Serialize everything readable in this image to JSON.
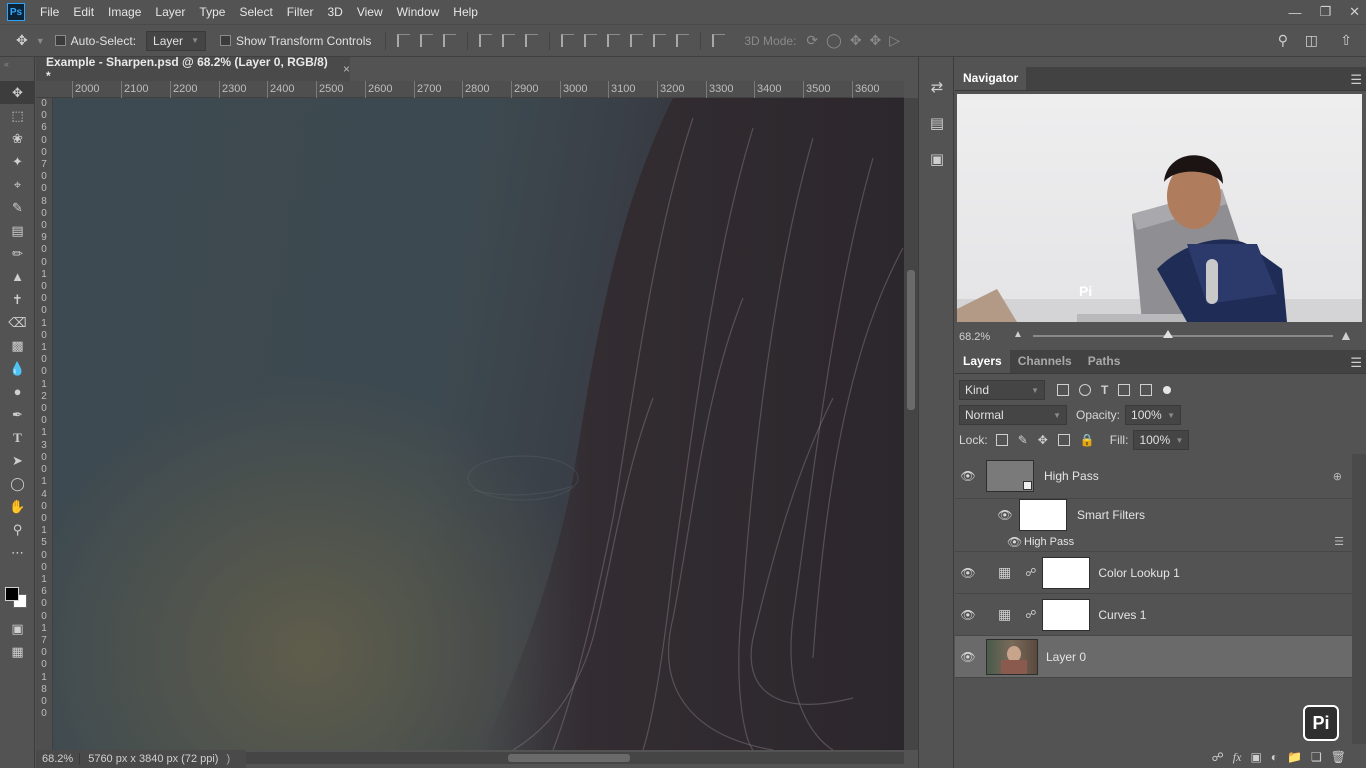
{
  "app": {
    "logo": "Ps",
    "menu": [
      "File",
      "Edit",
      "Image",
      "Layer",
      "Type",
      "Select",
      "Filter",
      "3D",
      "View",
      "Window",
      "Help"
    ],
    "window_controls": [
      "minimize-icon",
      "restore-icon",
      "close-icon"
    ]
  },
  "options": {
    "auto_select_label": "Auto-Select:",
    "auto_select_value": "Layer",
    "show_transform_label": "Show Transform Controls",
    "mode_3d_label": "3D Mode:"
  },
  "document": {
    "tab_title": "Example - Sharpen.psd @ 68.2% (Layer 0, RGB/8) *",
    "close_glyph": "×",
    "ruler_ticks": [
      "2000",
      "2100",
      "2200",
      "2300",
      "2400",
      "2500",
      "2600",
      "2700",
      "2800",
      "2900",
      "3000",
      "3100",
      "3200",
      "3300",
      "3400",
      "3500",
      "3600"
    ],
    "left_ruler_labels": [
      "0",
      "0",
      "6",
      "0",
      "0",
      "7",
      "0",
      "0",
      "8",
      "0",
      "0",
      "9",
      "0",
      "0",
      "1",
      "0",
      "0",
      "0",
      "1",
      "0",
      "1",
      "0",
      "0",
      "1",
      "2",
      "0",
      "0",
      "1",
      "3",
      "0",
      "0",
      "1",
      "4",
      "0",
      "0",
      "1",
      "5",
      "0",
      "0",
      "1",
      "6",
      "0",
      "0",
      "1",
      "7",
      "0",
      "0",
      "1",
      "8",
      "0",
      "0"
    ]
  },
  "status": {
    "zoom": "68.2%",
    "doc_info": "5760 px x 3840 px (72 ppi)",
    "arrow": ")"
  },
  "navigator": {
    "title": "Navigator",
    "zoom": "68.2%",
    "zoom_level": 0.45
  },
  "layers": {
    "tabs": [
      "Layers",
      "Channels",
      "Paths"
    ],
    "active_tab": "Layers",
    "kind_label": "Kind",
    "blend_mode": "Normal",
    "opacity_label": "Opacity:",
    "opacity_value": "100%",
    "lock_label": "Lock:",
    "fill_label": "Fill:",
    "fill_value": "100%",
    "items": [
      {
        "name": "High Pass",
        "type": "smart-object"
      },
      {
        "name": "Smart Filters",
        "type": "smart-filters"
      },
      {
        "name": "High Pass",
        "type": "filter"
      },
      {
        "name": "Color Lookup 1",
        "type": "adjustment"
      },
      {
        "name": "Curves 1",
        "type": "adjustment"
      },
      {
        "name": "Layer 0",
        "type": "pixel",
        "selected": true
      }
    ]
  },
  "colors": {
    "accent": "#31a8ff",
    "panel": "#535353",
    "panel_dark": "#424242"
  },
  "watermark": "Pi"
}
